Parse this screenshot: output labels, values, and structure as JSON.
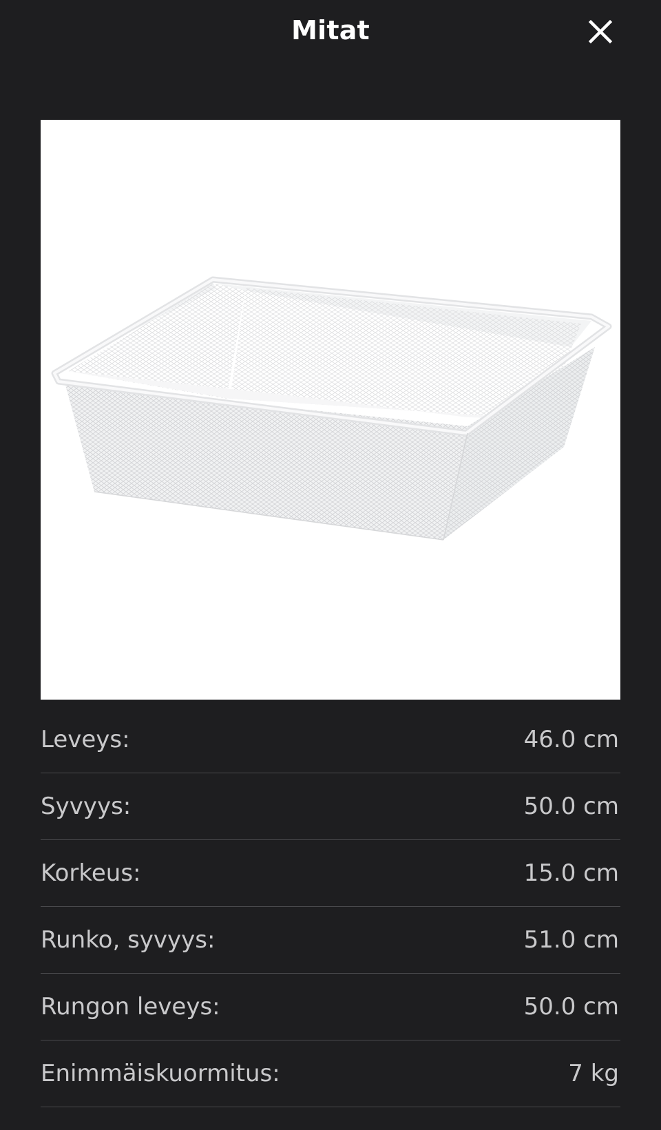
{
  "header": {
    "title": "Mitat",
    "close_icon": "close-icon"
  },
  "product_image": {
    "icon": "wire-mesh-basket-image",
    "background": "#ffffff"
  },
  "dimensions": [
    {
      "label": "Leveys:",
      "value": "46.0 cm"
    },
    {
      "label": "Syvyys:",
      "value": "50.0 cm"
    },
    {
      "label": "Korkeus:",
      "value": "15.0 cm"
    },
    {
      "label": "Runko, syvyys:",
      "value": "51.0 cm"
    },
    {
      "label": "Rungon leveys:",
      "value": "50.0 cm"
    },
    {
      "label": "Enimmäiskuormitus:",
      "value": "7 kg"
    }
  ],
  "colors": {
    "background": "#1e1e20",
    "title": "#ffffff",
    "text": "#c9c9cb",
    "divider": "#4a4a4d"
  }
}
